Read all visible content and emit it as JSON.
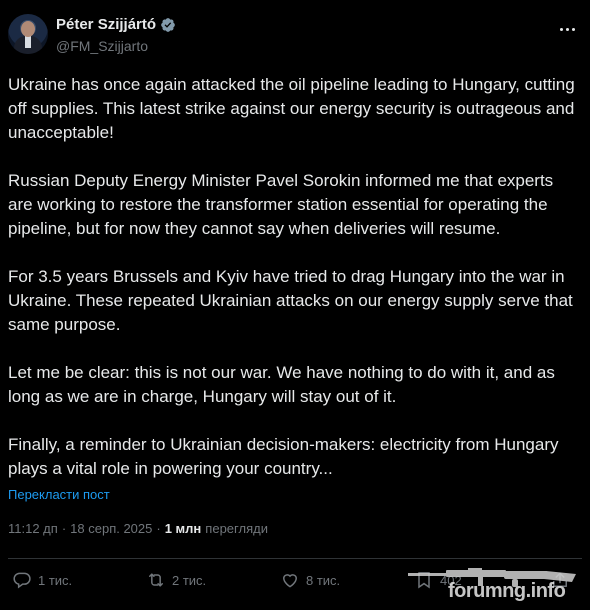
{
  "post": {
    "author_name": "Péter Szijjártó",
    "author_handle": "@FM_Szijjarto",
    "paragraphs": [
      "Ukraine has once again attacked the oil pipeline leading to Hungary, cutting off supplies. This latest strike against our energy security is outrageous and unacceptable!",
      "Russian Deputy Energy Minister Pavel Sorokin informed me that experts are working to restore the transformer station essential for operating the pipeline, but for now they cannot say when deliveries will resume.",
      "For 3.5 years Brussels and Kyiv have tried to drag Hungary into the war in Ukraine. These repeated Ukrainian attacks on our energy supply serve that same purpose.",
      "Let me be clear: this is not our war. We have nothing to do with it, and as long as we are in charge, Hungary will stay out of it.",
      "Finally, a reminder to Ukrainian decision-makers: electricity from Hungary plays a vital role in powering your country..."
    ],
    "translate_label": "Перекласти пост",
    "time": "11:12 дп",
    "date": "18 серп. 2025",
    "views_count": "1 млн",
    "views_label": "перегляди"
  },
  "actions": {
    "replies": "1 тис.",
    "reposts": "2 тис.",
    "likes": "8 тис.",
    "bookmarks": "402"
  },
  "watermark": {
    "text": "forumng.info"
  },
  "colors": {
    "background": "#000000",
    "text": "#e7e9ea",
    "muted": "#71767b",
    "link": "#1d9bf0",
    "verified_badge": "#829aab"
  }
}
